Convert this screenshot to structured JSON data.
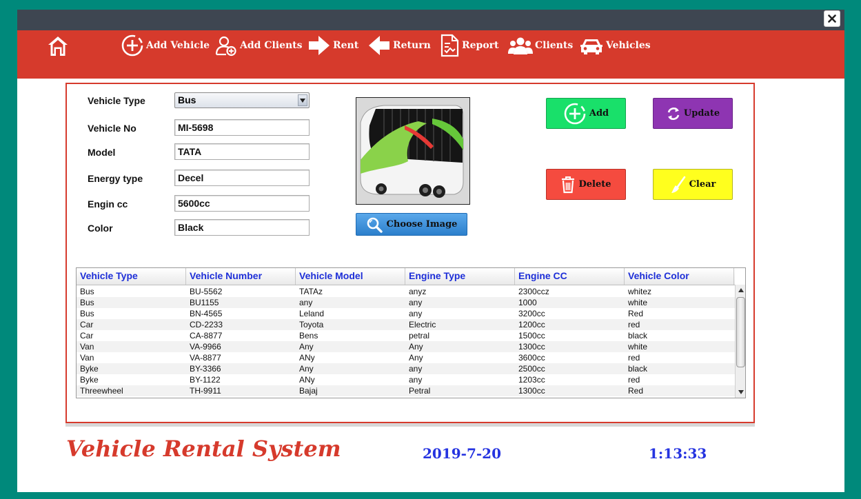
{
  "nav": {
    "items": [
      {
        "label": "Add Vehicle"
      },
      {
        "label": "Add Clients"
      },
      {
        "label": "Rent"
      },
      {
        "label": "Return"
      },
      {
        "label": "Report"
      },
      {
        "label": "Clients"
      },
      {
        "label": "Vehicles"
      }
    ]
  },
  "form": {
    "vehicle_type_label": "Vehicle Type",
    "vehicle_type_value": "Bus",
    "vehicle_no_label": "Vehicle No",
    "vehicle_no_value": "MI-5698",
    "model_label": "Model",
    "model_value": "TATA",
    "energy_type_label": "Energy type",
    "energy_type_value": "Decel",
    "engine_cc_label": "Engin cc",
    "engine_cc_value": "5600cc",
    "color_label": "Color",
    "color_value": "Black"
  },
  "image": {
    "choose_label": "Choose Image"
  },
  "actions": {
    "add_label": "Add",
    "update_label": "Update",
    "delete_label": "Delete",
    "clear_label": "Clear",
    "add_color": "#19e06a",
    "update_color": "#8e35b2",
    "delete_color": "#f54b3f",
    "clear_color": "#ffff1e"
  },
  "table": {
    "columns": [
      "Vehicle Type",
      "Vehicle Number",
      "Vehicle Model",
      "Engine Type",
      "Engine CC",
      "Vehicle Color"
    ],
    "rows": [
      [
        "Bus",
        "BU-5562",
        "TATAz",
        "anyz",
        "2300ccz",
        "whitez"
      ],
      [
        "Bus",
        "BU1155",
        "any",
        "any",
        "1000",
        "white"
      ],
      [
        "Bus",
        "BN-4565",
        "Leland",
        "any",
        "3200cc",
        "Red"
      ],
      [
        "Car",
        "CD-2233",
        "Toyota",
        "Electric",
        "1200cc",
        "red"
      ],
      [
        "Car",
        "CA-8877",
        "Bens",
        "petral",
        "1500cc",
        "black"
      ],
      [
        "Van",
        "VA-9966",
        "Any",
        "Any",
        "1300cc",
        "white"
      ],
      [
        "Van",
        "VA-8877",
        "ANy",
        "Any",
        "3600cc",
        "red"
      ],
      [
        "Byke",
        "BY-3366",
        "Any",
        "any",
        "2500cc",
        "black"
      ],
      [
        "Byke",
        "BY-1122",
        "ANy",
        "any",
        "1203cc",
        "red"
      ],
      [
        "Threewheel",
        "TH-9911",
        "Bajaj",
        "Petral",
        "1300cc",
        "Red"
      ]
    ]
  },
  "footer": {
    "title": "Vehicle Rental System",
    "date": "2019-7-20",
    "time": "1:13:33"
  },
  "colors": {
    "brand_red": "#d63a2c",
    "background_teal": "#00897b",
    "titlebar": "#3e4651",
    "accent_blue": "#2533e0"
  }
}
